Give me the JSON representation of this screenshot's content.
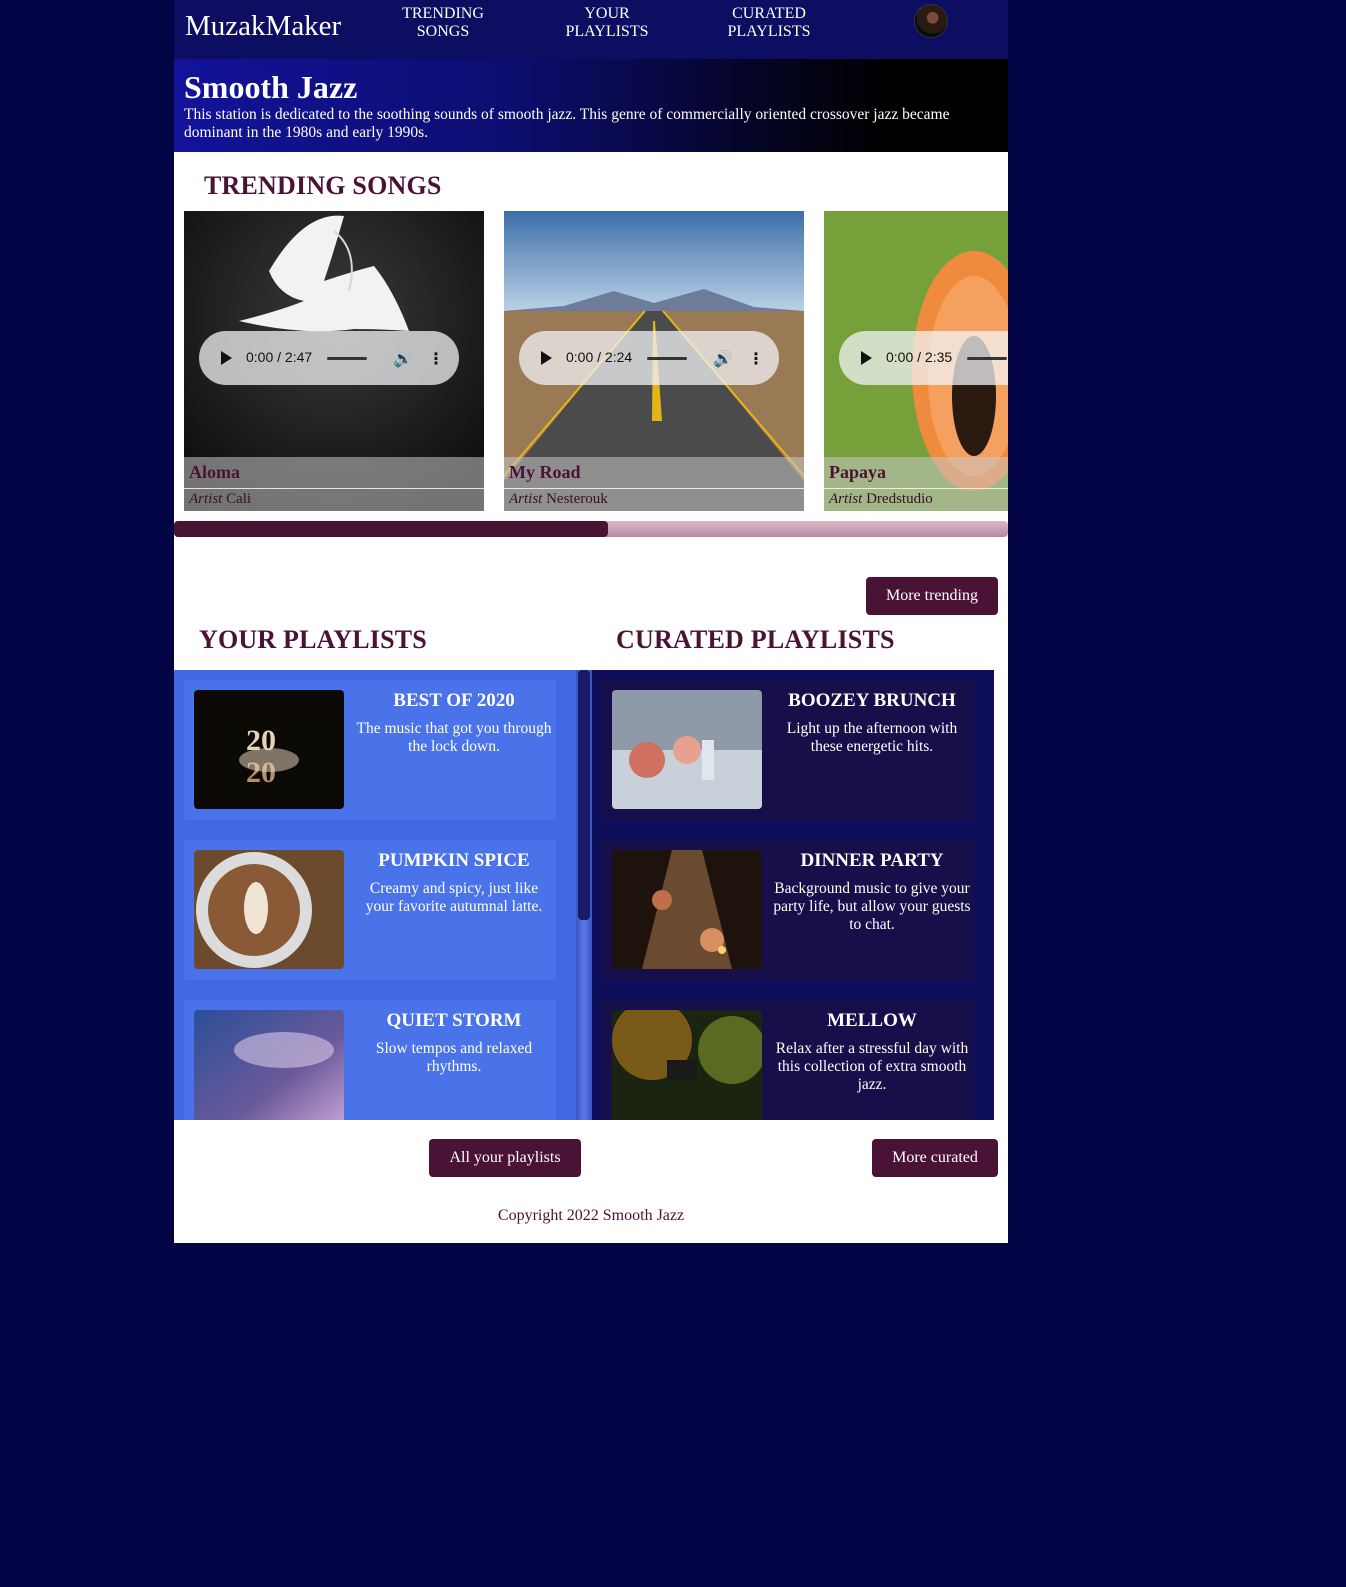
{
  "header": {
    "brand": "MuzakMaker",
    "nav": [
      {
        "line1": "TRENDING",
        "line2": "SONGS"
      },
      {
        "line1": "YOUR",
        "line2": "PLAYLISTS"
      },
      {
        "line1": "CURATED",
        "line2": "PLAYLISTS"
      }
    ],
    "avatar_icon": "user-avatar"
  },
  "hero": {
    "title": "Smooth Jazz",
    "description": "This station is dedicated to the soothing sounds of smooth jazz. This genre of commercially oriented crossover jazz became dominant in the 1980s and early 1990s."
  },
  "trending": {
    "title": "TRENDING SONGS",
    "artist_label": "Artist",
    "songs": [
      {
        "name": "Aloma",
        "artist": "Cali",
        "time": "0:00 / 2:47"
      },
      {
        "name": "My Road",
        "artist": "Nesterouk",
        "time": "0:00 / 2:24"
      },
      {
        "name": "Papaya",
        "artist": "Dredstudio",
        "time": "0:00 / 2:35"
      }
    ],
    "scroll_fraction": 0.52,
    "more_button": "More trending"
  },
  "your_playlists": {
    "title": "YOUR PLAYLISTS",
    "items": [
      {
        "name": "BEST OF 2020",
        "desc": "The music that got you through the lock down."
      },
      {
        "name": "PUMPKIN SPICE",
        "desc": "Creamy and spicy, just like your favorite autumnal latte."
      },
      {
        "name": "QUIET STORM",
        "desc": "Slow tempos and relaxed rhythms."
      }
    ],
    "button": "All your playlists"
  },
  "curated_playlists": {
    "title": "CURATED PLAYLISTS",
    "items": [
      {
        "name": "BOOZEY BRUNCH",
        "desc": "Light up the afternoon with these energetic hits."
      },
      {
        "name": "DINNER PARTY",
        "desc": "Background music to give your party life, but allow your guests to chat."
      },
      {
        "name": "MELLOW",
        "desc": "Relax after a stressful day with this collection of extra smooth jazz."
      }
    ],
    "button": "More curated"
  },
  "footer": {
    "copyright": "Copyright 2022 Smooth Jazz"
  },
  "colors": {
    "accent": "#4a1235",
    "nav_bg": "#0d0d62",
    "page_bg": "#020446",
    "your_panel": "#4169e1",
    "curated_panel": "#0d0d5a",
    "curated_card": "#160f4a"
  }
}
